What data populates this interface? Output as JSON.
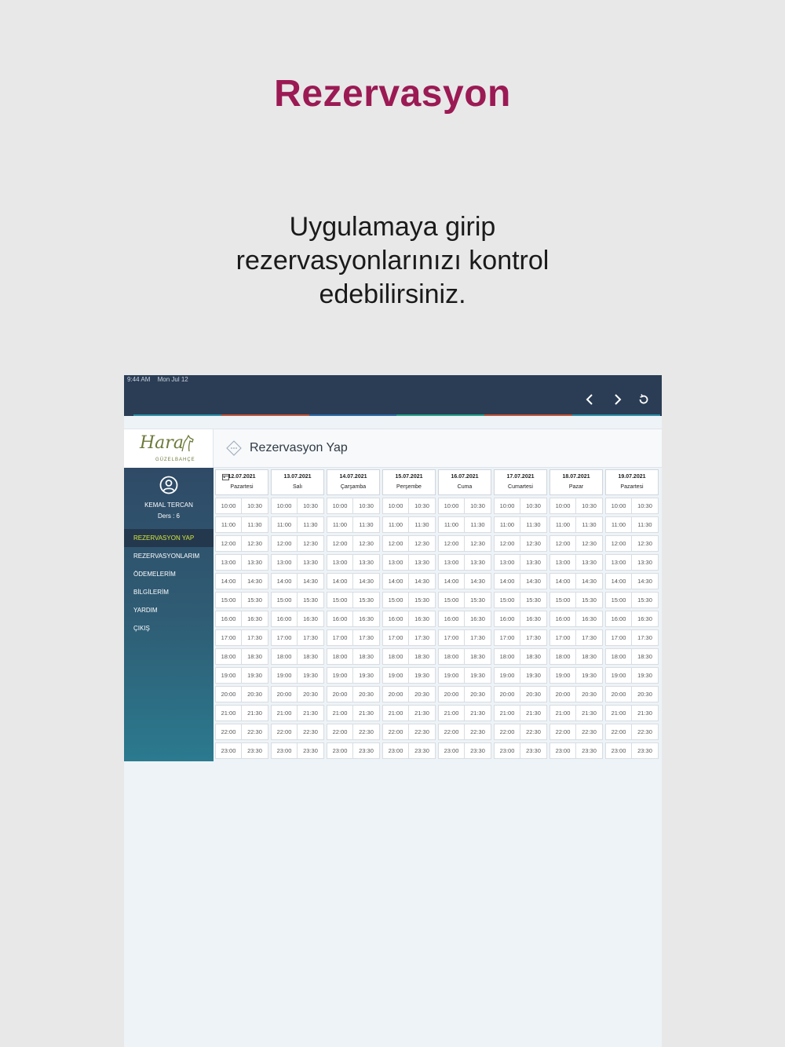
{
  "promo": {
    "title": "Rezervasyon",
    "subtitle_line1": "Uygulamaya girip",
    "subtitle_line2": "rezervasyonlarınızı kontrol",
    "subtitle_line3": "edebilirsiniz."
  },
  "status_bar": {
    "time": "9:44 AM",
    "date": "Mon Jul 12"
  },
  "toolbar": {
    "back_icon": "chevron-left-icon",
    "forward_icon": "chevron-right-icon",
    "refresh_icon": "refresh-icon"
  },
  "colors": {
    "brand": "#9b1a54",
    "topbar": "#2b3d55",
    "active_menu_text": "#d6e93a",
    "accent": [
      "#2e8fa6",
      "#c0563a",
      "#2e6ba6",
      "#29a08a",
      "#c0563a",
      "#2e8fa6"
    ]
  },
  "logo": {
    "script": "Hara",
    "sub": "GÜZELBAHÇE"
  },
  "page": {
    "title": "Rezervasyon Yap"
  },
  "profile": {
    "name": "KEMAL TERCAN",
    "lessons": "Ders : 6"
  },
  "menu": [
    {
      "label": "REZERVASYON YAP",
      "active": true
    },
    {
      "label": "REZERVASYONLARIM",
      "active": false
    },
    {
      "label": "ÖDEMELERİM",
      "active": false
    },
    {
      "label": "BİLGİLERİM",
      "active": false
    },
    {
      "label": "YARDIM",
      "active": false
    },
    {
      "label": "ÇIKIŞ",
      "active": false
    }
  ],
  "days": [
    {
      "date": "12.07.2021",
      "day": "Pazartesi"
    },
    {
      "date": "13.07.2021",
      "day": "Salı"
    },
    {
      "date": "14.07.2021",
      "day": "Çarşamba"
    },
    {
      "date": "15.07.2021",
      "day": "Perşembe"
    },
    {
      "date": "16.07.2021",
      "day": "Cuma"
    },
    {
      "date": "17.07.2021",
      "day": "Cumartesi"
    },
    {
      "date": "18.07.2021",
      "day": "Pazar"
    },
    {
      "date": "19.07.2021",
      "day": "Pazartesi"
    }
  ],
  "time_slots": [
    [
      "10:00",
      "10:30"
    ],
    [
      "11:00",
      "11:30"
    ],
    [
      "12:00",
      "12:30"
    ],
    [
      "13:00",
      "13:30"
    ],
    [
      "14:00",
      "14:30"
    ],
    [
      "15:00",
      "15:30"
    ],
    [
      "16:00",
      "16:30"
    ],
    [
      "17:00",
      "17:30"
    ],
    [
      "18:00",
      "18:30"
    ],
    [
      "19:00",
      "19:30"
    ],
    [
      "20:00",
      "20:30"
    ],
    [
      "21:00",
      "21:30"
    ],
    [
      "22:00",
      "22:30"
    ],
    [
      "23:00",
      "23:30"
    ]
  ]
}
